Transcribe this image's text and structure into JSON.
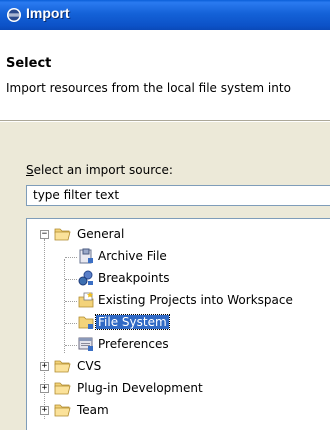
{
  "window": {
    "title": "Import",
    "icon": "eclipse-icon"
  },
  "header": {
    "title": "Select",
    "description": "Import resources from the local file system into"
  },
  "source": {
    "label_mnemonic": "S",
    "label_rest": "elect an import source:",
    "filter_value": "type filter text"
  },
  "tree": {
    "general": "General",
    "children": [
      "Archive File",
      "Breakpoints",
      "Existing Projects into Workspace",
      "File System",
      "Preferences"
    ],
    "selected": "File System",
    "cvs": "CVS",
    "plugin": "Plug-in Development",
    "team": "Team"
  }
}
